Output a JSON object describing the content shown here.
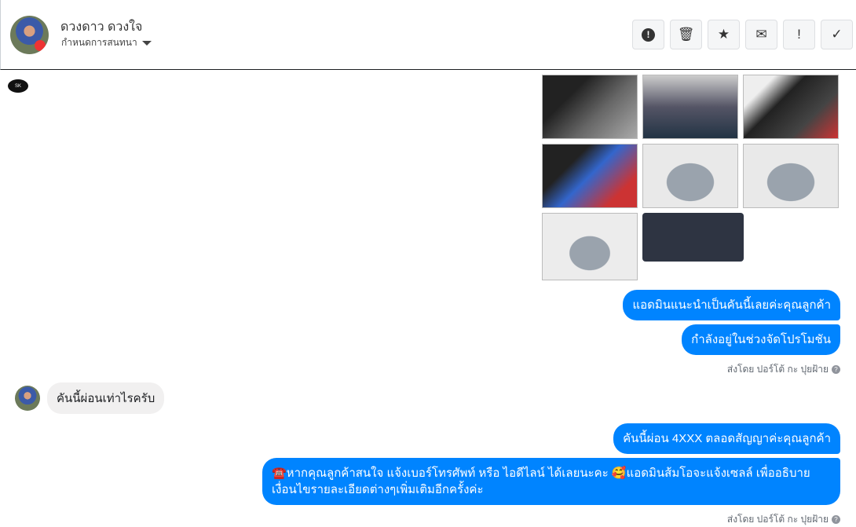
{
  "header": {
    "name": "ดวงดาว ดวงใจ",
    "subtitle": "กำหนดการสนทนา",
    "buttons": [
      {
        "name": "spam",
        "icon": "!"
      },
      {
        "name": "delete",
        "icon": "🗑"
      },
      {
        "name": "star",
        "icon": "★"
      },
      {
        "name": "mark-unread",
        "icon": "✉"
      },
      {
        "name": "important",
        "icon": "!"
      },
      {
        "name": "done",
        "icon": "✓"
      }
    ]
  },
  "page_logo": "SK",
  "messages": {
    "group1": [
      "แอดมินแนะนำเป็นคันนี้เลยค่ะคุณลูกค้า",
      "กำลังอยู่ในช่วงจัดโปรโมชัน"
    ],
    "sent_by": "ส่งโดย ปอร์โต้ กะ ปุยฝ้าย",
    "incoming": "คันนี้ผ่อนเท่าไรครับ",
    "group2": [
      "คันนี้ผ่อน 4XXX ตลอดสัญญาค่ะคุณลูกค้า",
      "☎️หากคุณลูกค้าสนใจ แจ้งเบอร์โทรศัพท์ หรือ ไอดีไลน์  ได้เลยนะคะ 🥰แอดมินส้มโอจะแจ้งเซลล์   เพื่ออธิบายเงื่อนไขรายละเอียดต่างๆเพิ่มเติมอีกครั้งค่ะ"
    ],
    "sent_by_2": "ส่งโดย ปอร์โต้ กะ ปุยฝ้าย"
  },
  "help_icon": "?"
}
